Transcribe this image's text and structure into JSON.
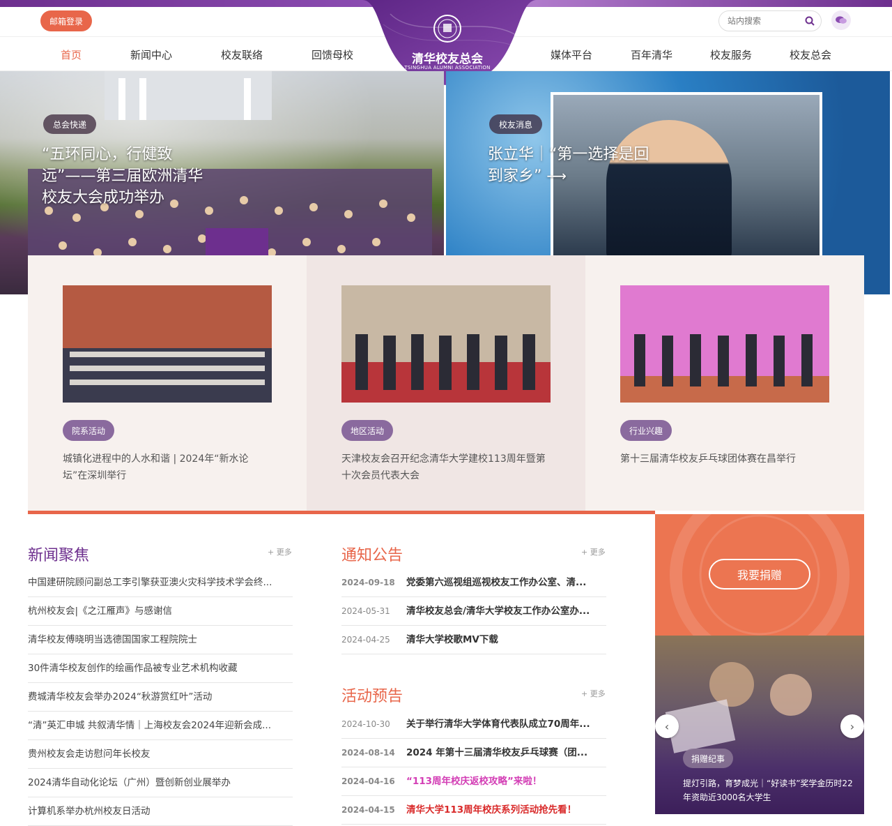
{
  "header": {
    "mail_login": "邮箱登录",
    "search_placeholder": "站内搜索",
    "logo_title": "清华校友总会",
    "logo_subtitle": "TSINGHUA ALUMNI ASSOCIATION",
    "nav_left": [
      "首页",
      "新闻中心",
      "校友联络",
      "回馈母校"
    ],
    "nav_right": [
      "媒体平台",
      "百年清华",
      "校友服务",
      "校友总会"
    ],
    "active_nav": "首页",
    "accent_color": "#e8664a",
    "brand_color": "#6d2f8e"
  },
  "hero": {
    "left": {
      "badge": "总会快递",
      "title": "“五环同心，行健致远”——第三届欧洲清华校友大会成功举办"
    },
    "right": {
      "badge": "校友消息",
      "title": "张立华｜“第一选择是回到家乡”"
    }
  },
  "cards": [
    {
      "tag": "院系活动",
      "desc": "城镇化进程中的人水和谐 | 2024年“新水论坛”在深圳举行"
    },
    {
      "tag": "地区活动",
      "desc": "天津校友会召开纪念清华大学建校113周年暨第十次会员代表大会"
    },
    {
      "tag": "行业兴趣",
      "desc": "第十三届清华校友乒乓球团体赛在昌举行"
    }
  ],
  "news_focus": {
    "title": "新闻聚焦",
    "more": "+ 更多",
    "items": [
      "中国建研院顾问副总工李引擎获亚澳火灾科学技术学会终...",
      "杭州校友会|《之江雁声》与感谢信",
      "清华校友傅晓明当选德国国家工程院院士",
      "30件清华校友创作的绘画作品被专业艺术机构收藏",
      "费城清华校友会举办2024“秋游赏红叶”活动",
      "“清”英汇申城 共叙清华情｜上海校友会2024年迎新会成...",
      "贵州校友会走访慰问年长校友",
      "2024清华自动化论坛（广州）暨创新创业展举办",
      "计算机系举办杭州校友日活动"
    ]
  },
  "notices": {
    "title": "通知公告",
    "more": "+ 更多",
    "items": [
      {
        "date": "2024-09-18",
        "title": "党委第六巡视组巡视校友工作办公室、清..."
      },
      {
        "date": "2024-05-31",
        "title": "清华校友总会/清华大学校友工作办公室办..."
      },
      {
        "date": "2024-04-25",
        "title": "清华大学校歌MV下载"
      }
    ]
  },
  "events": {
    "title": "活动预告",
    "more": "+ 更多",
    "items": [
      {
        "date": "2024-10-30",
        "title": "关于举行清华大学体育代表队成立70周年..."
      },
      {
        "date": "2024-08-14",
        "title": "2024 年第十三届清华校友乒乓球赛（团..."
      },
      {
        "date": "2024-04-16",
        "title": "“113周年校庆返校攻略”来啦！"
      },
      {
        "date": "2024-04-15",
        "title": "清华大学113周年校庆系列活动抢先看！"
      }
    ]
  },
  "donate": {
    "button": "我要捐赠",
    "story_tag": "捐赠纪事",
    "story_title": "提灯引路，育梦成光｜“好读书”奖学金历时22年资助近3000名大学生"
  }
}
